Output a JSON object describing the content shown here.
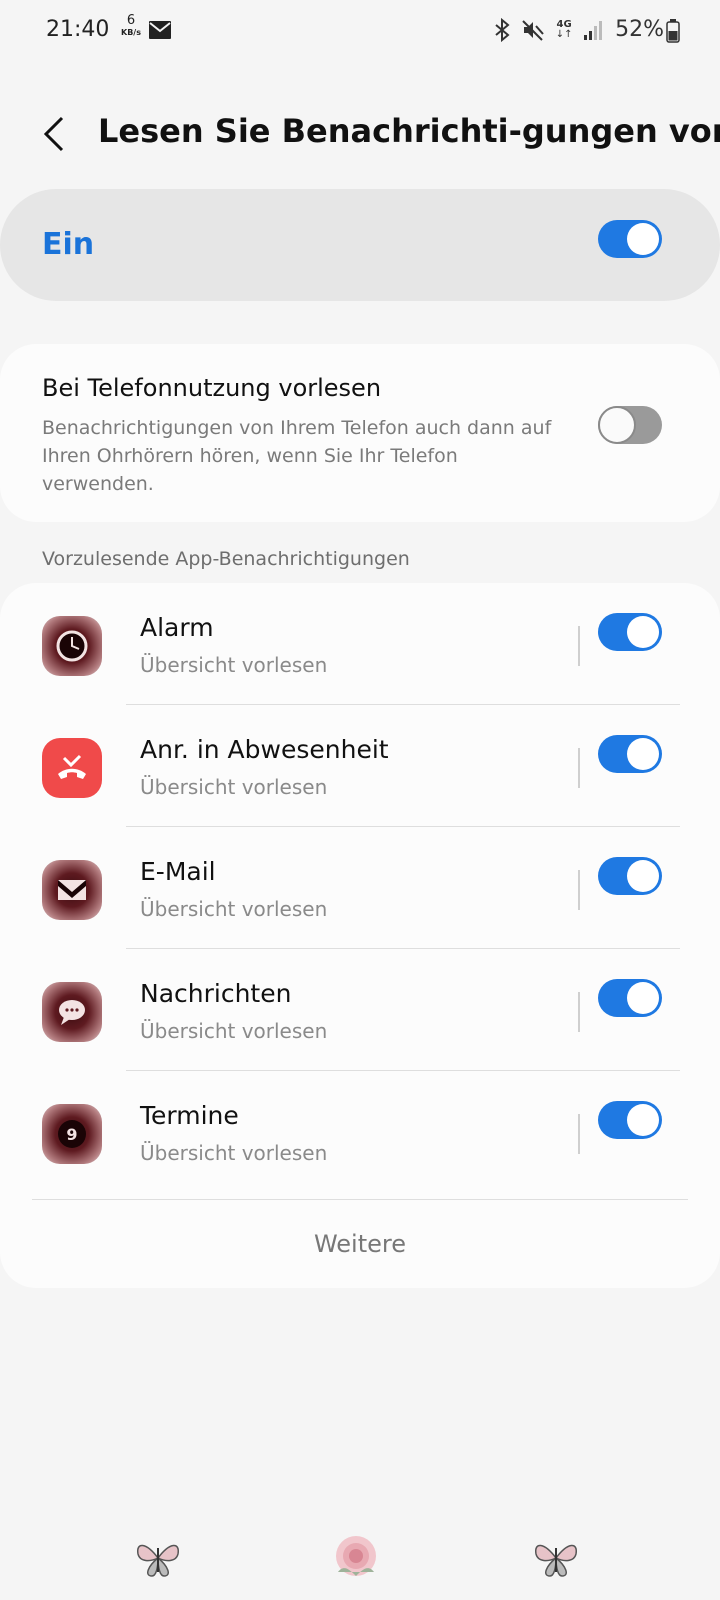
{
  "status_bar": {
    "time": "21:40",
    "net_speed_value": "6",
    "net_speed_unit": "KB/s",
    "network_type": "4G",
    "battery_text": "52%",
    "icons": [
      "mail-icon",
      "bluetooth-icon",
      "mute-icon",
      "network-4g-icon",
      "signal-icon",
      "battery-icon"
    ]
  },
  "header": {
    "title": "Lesen Sie Benachrichti-gungen vor",
    "back_icon": "chevron-left-icon"
  },
  "master_switch": {
    "label": "Ein",
    "on": true
  },
  "phone_usage": {
    "title": "Bei Telefonnutzung vorlesen",
    "description": "Benachrichtigungen von Ihrem Telefon auch dann auf Ihren Ohrhörern hören, wenn Sie Ihr Telefon verwenden.",
    "on": false
  },
  "section_header": "Vorzulesende App-Benachrichtigungen",
  "apps": [
    {
      "name": "Alarm",
      "subtitle": "Übersicht vorlesen",
      "icon": "alarm-clock-icon",
      "on": true
    },
    {
      "name": "Anr. in Abwesenheit",
      "subtitle": "Übersicht vorlesen",
      "icon": "missed-call-icon",
      "on": true
    },
    {
      "name": "E-Mail",
      "subtitle": "Übersicht vorlesen",
      "icon": "email-icon",
      "on": true
    },
    {
      "name": "Nachrichten",
      "subtitle": "Übersicht vorlesen",
      "icon": "messages-icon",
      "on": true
    },
    {
      "name": "Termine",
      "subtitle": "Übersicht vorlesen",
      "icon": "calendar-icon",
      "calendar_day": "9",
      "on": true
    }
  ],
  "more_label": "Weitere",
  "colors": {
    "accent": "#1a73d9",
    "toggle_on": "#1f79e2",
    "toggle_off": "#9a9a9a",
    "background": "#f5f5f5",
    "missed_call_red": "#f04a4a"
  },
  "nav_bar": {
    "icons": [
      "recent-apps-icon",
      "home-icon",
      "back-nav-icon"
    ]
  }
}
